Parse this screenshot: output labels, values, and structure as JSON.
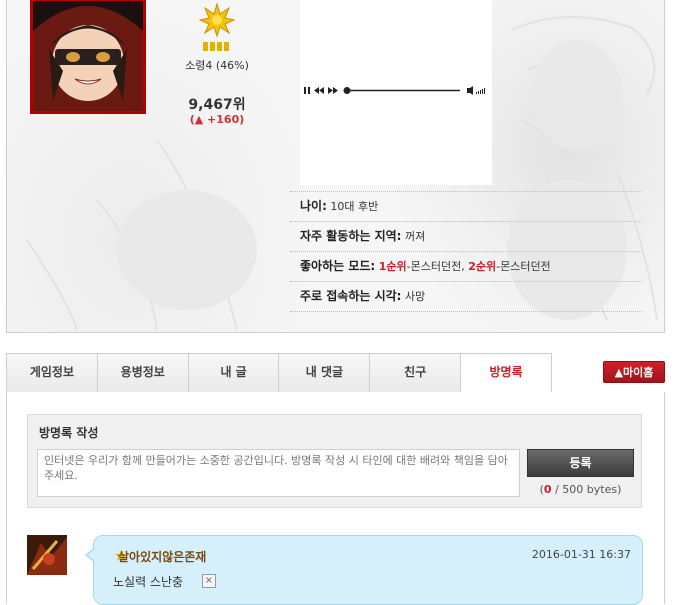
{
  "profile": {
    "level_text": "소령4 (46%)",
    "rank": "9,467위",
    "rank_change": "(▲ +160)",
    "info": {
      "age_label": "나이:",
      "age_value": "10대 후반",
      "region_label": "자주 활동하는 지역:",
      "region_value": "꺼져",
      "mode_label": "좋아하는 모드:",
      "mode_rank1": "1순위",
      "mode_value1": "-몬스터던전,",
      "mode_rank2": "2순위",
      "mode_value2": "-몬스터던전",
      "time_label": "주로 접속하는 시각:",
      "time_value": "사망"
    }
  },
  "tabs": [
    {
      "label": "게임정보"
    },
    {
      "label": "용병정보"
    },
    {
      "label": "내 글"
    },
    {
      "label": "내 댓글"
    },
    {
      "label": "친구"
    },
    {
      "label": "방명록"
    }
  ],
  "myhome_label": "마이홈",
  "guestbook": {
    "title": "방명록 작성",
    "placeholder": "인터넷은 우리가 함께 만들어가는 소중한 공간입니다. 방명록 작성 시 타인에 대한 배려와 책임을 담아주세요.",
    "submit_label": "등록",
    "bytes_open": "(",
    "bytes_count": "0",
    "bytes_rest": " / 500 bytes)"
  },
  "entry": {
    "author": "살아있지않은존재",
    "date": "2016-01-31 16:37",
    "text": "노실력 스난충",
    "delete_glyph": "×"
  },
  "colors": {
    "accent_red": "#c8202a",
    "bubble_bg": "#d6f0fb",
    "active_tab_text": "#c8202a"
  }
}
